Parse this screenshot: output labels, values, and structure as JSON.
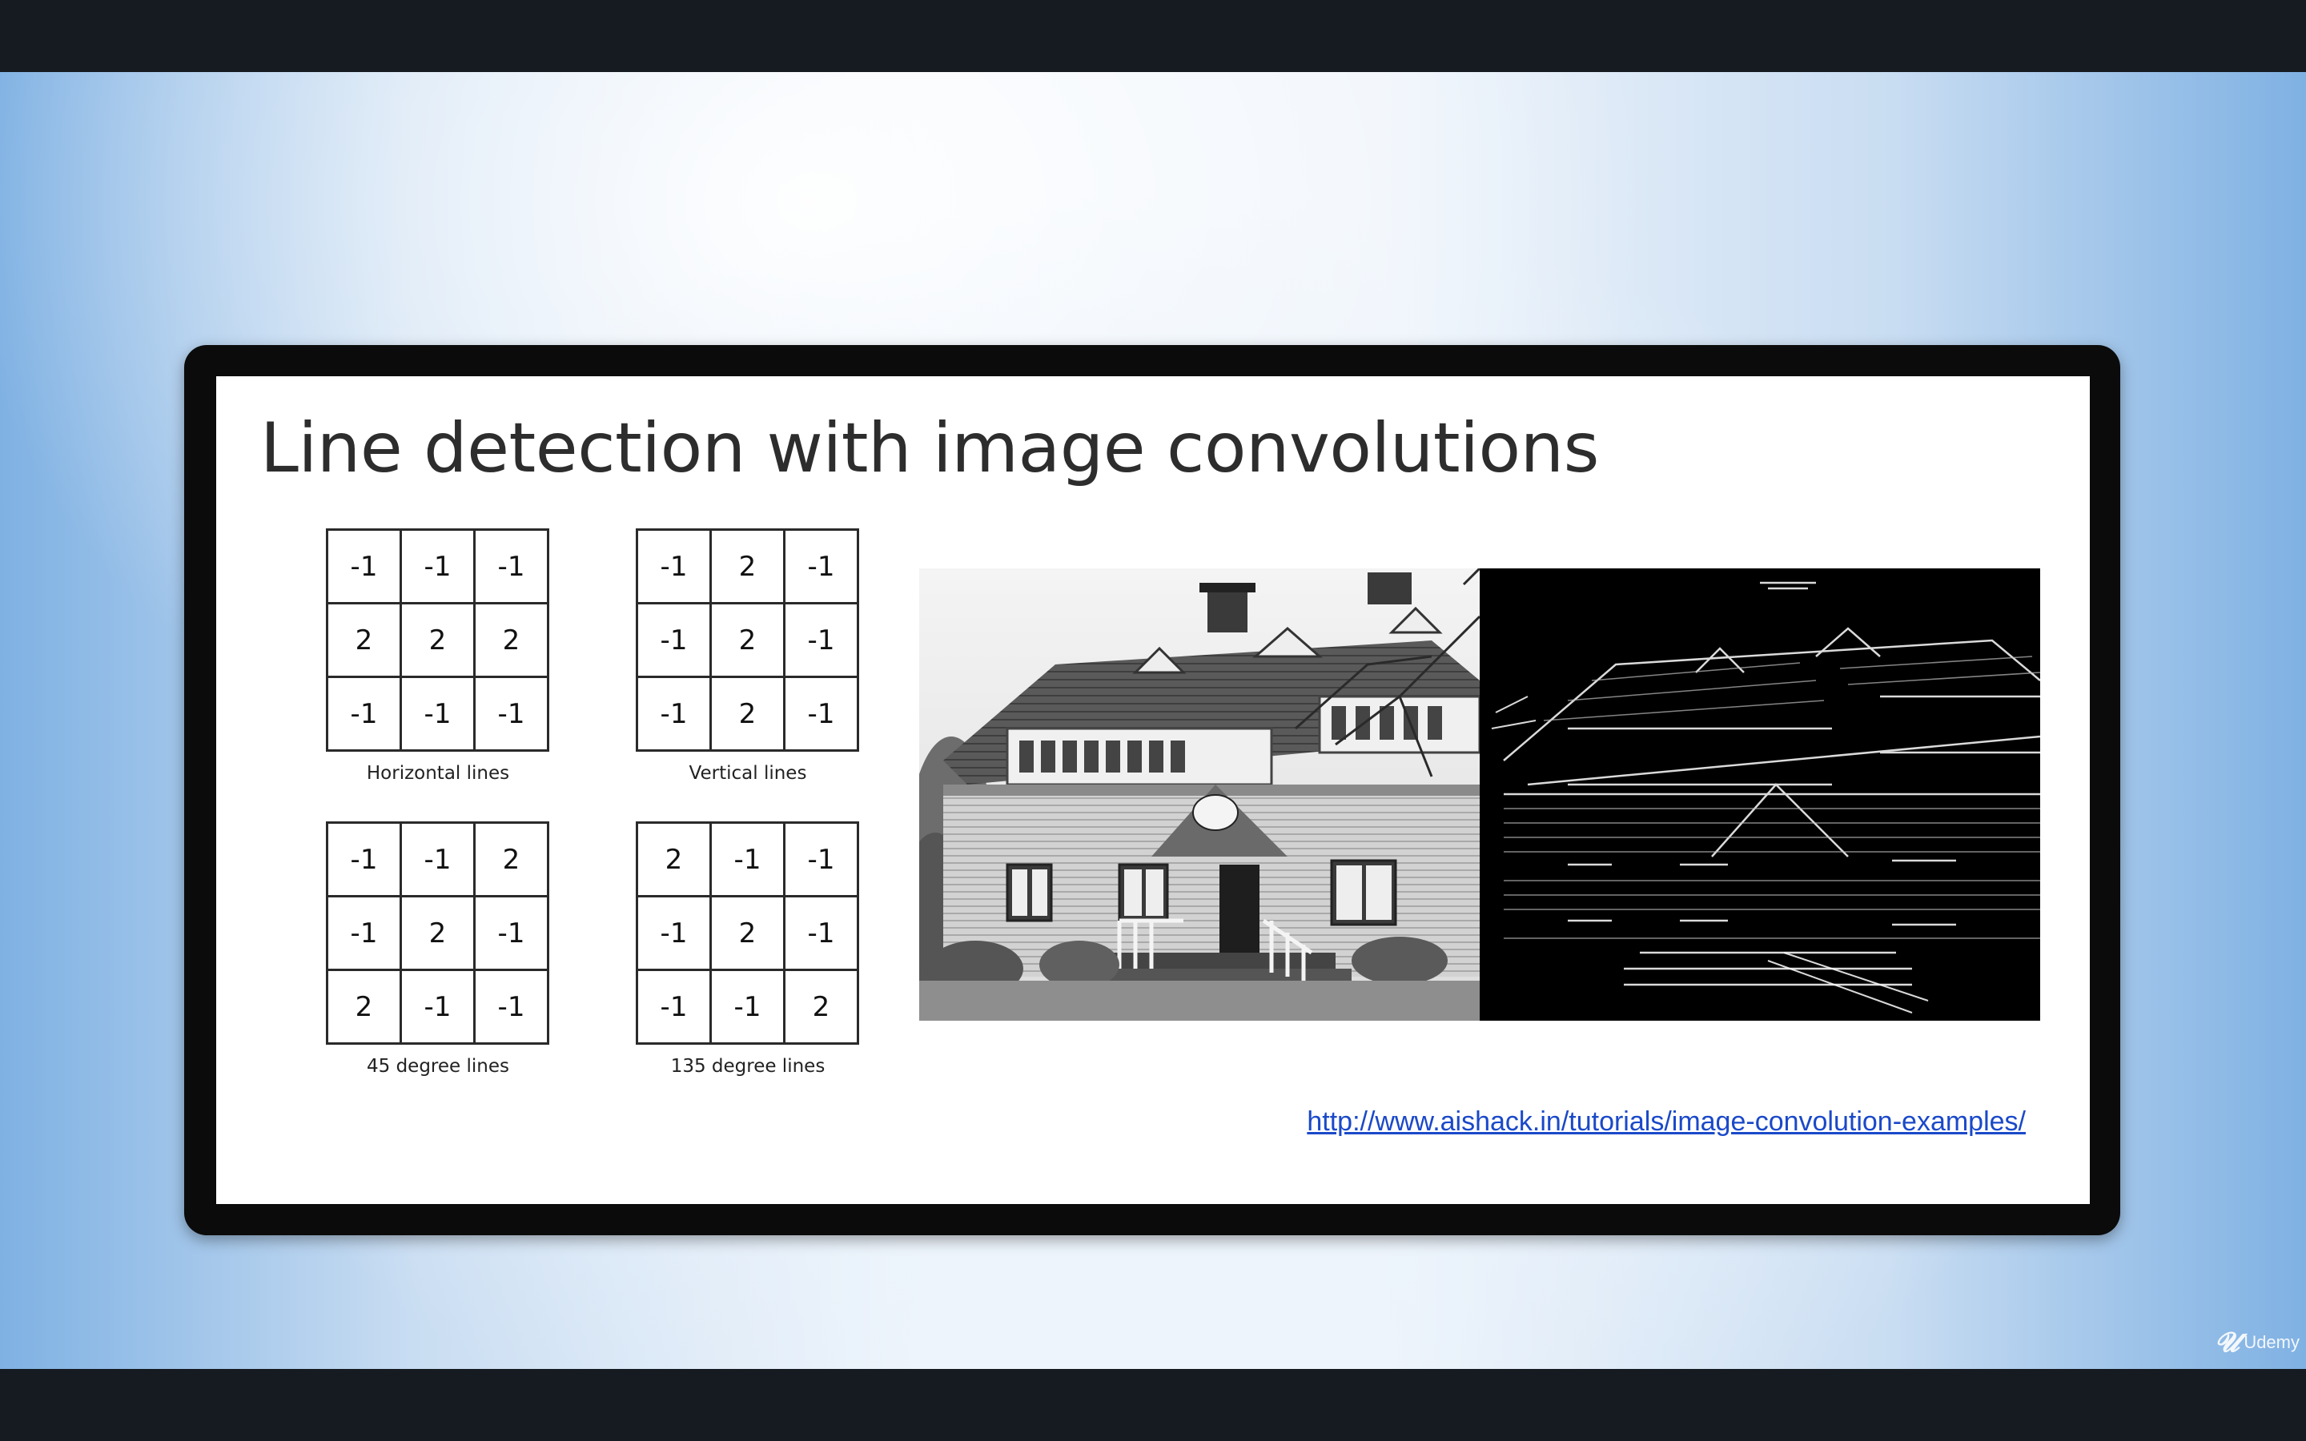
{
  "slide": {
    "title": "Line detection with image convolutions",
    "kernels": [
      {
        "caption": "Horizontal lines",
        "values": [
          "-1",
          "-1",
          "-1",
          "2",
          "2",
          "2",
          "-1",
          "-1",
          "-1"
        ]
      },
      {
        "caption": "Vertical lines",
        "values": [
          "-1",
          "2",
          "-1",
          "-1",
          "2",
          "-1",
          "-1",
          "2",
          "-1"
        ]
      },
      {
        "caption": "45 degree lines",
        "values": [
          "-1",
          "-1",
          "2",
          "-1",
          "2",
          "-1",
          "2",
          "-1",
          "-1"
        ]
      },
      {
        "caption": "135 degree lines",
        "values": [
          "2",
          "-1",
          "-1",
          "-1",
          "2",
          "-1",
          "-1",
          "-1",
          "2"
        ]
      }
    ],
    "link": "http://www.aishack.in/tutorials/image-convolution-examples/"
  },
  "watermark": {
    "icon": "udemy-logo-icon",
    "label": "Udemy"
  },
  "colors": {
    "link": "#1a49c9",
    "frame": "#0b0b0b",
    "page_bg": "#161a21"
  }
}
